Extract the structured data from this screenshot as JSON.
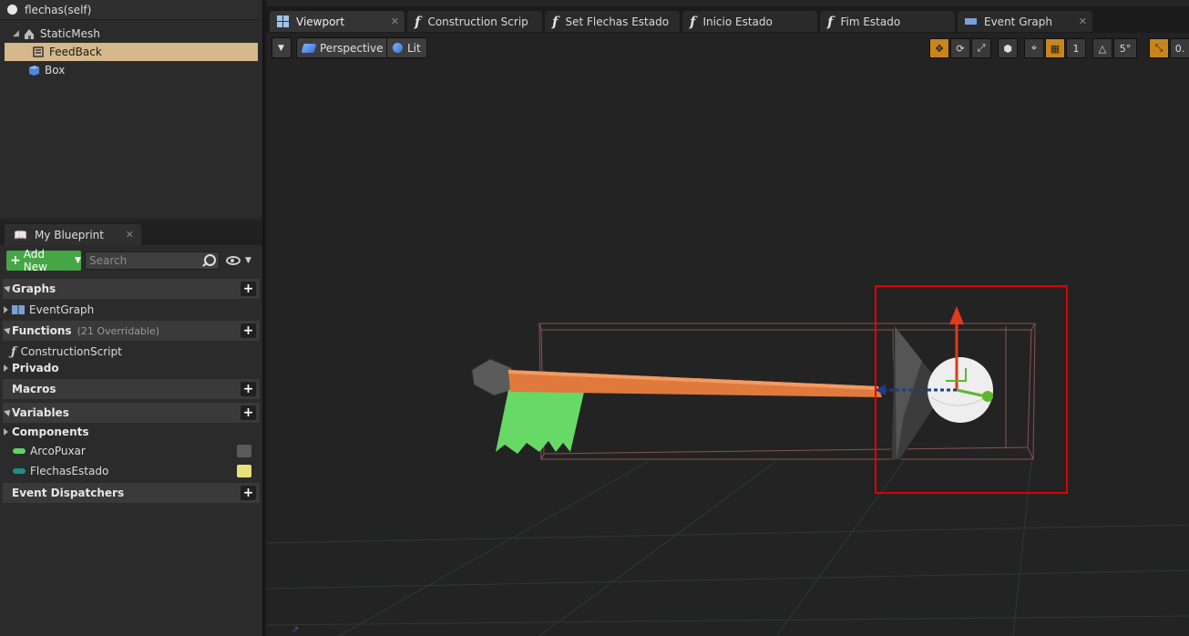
{
  "components": {
    "self_label": "flechas(self)",
    "items": [
      {
        "label": "StaticMesh"
      },
      {
        "label": "FeedBack"
      },
      {
        "label": "Box"
      }
    ]
  },
  "my_blueprint": {
    "tab_label": "My Blueprint",
    "add_new_label": "Add New",
    "search_placeholder": "Search",
    "sections": {
      "graphs": {
        "label": "Graphs",
        "items": [
          "EventGraph"
        ]
      },
      "functions": {
        "label": "Functions",
        "sub": "(21 Overridable)",
        "items": [
          "ConstructionScript",
          "Privado"
        ]
      },
      "macros": {
        "label": "Macros"
      },
      "variables": {
        "label": "Variables",
        "group": "Components",
        "items": [
          "ArcoPuxar",
          "FlechasEstado"
        ]
      },
      "dispatchers": {
        "label": "Event Dispatchers"
      }
    }
  },
  "tabs": [
    {
      "label": "Viewport",
      "icon": "viewport-grid-icon"
    },
    {
      "label": "Construction Scrip",
      "icon": "function-icon"
    },
    {
      "label": "Set Flechas Estado",
      "icon": "function-icon"
    },
    {
      "label": "Inicio Estado",
      "icon": "function-icon"
    },
    {
      "label": "Fim Estado",
      "icon": "function-icon"
    },
    {
      "label": "Event Graph",
      "icon": "event-graph-icon"
    }
  ],
  "viewport": {
    "view_mode": "Perspective",
    "lighting": "Lit",
    "snap_angle": "5°",
    "snap_grid_value": "1",
    "scale_value": "0.",
    "selection_color": "#e00000",
    "arrow_shaft_color": "#e07a3c",
    "fletching_color": "#66d966"
  }
}
